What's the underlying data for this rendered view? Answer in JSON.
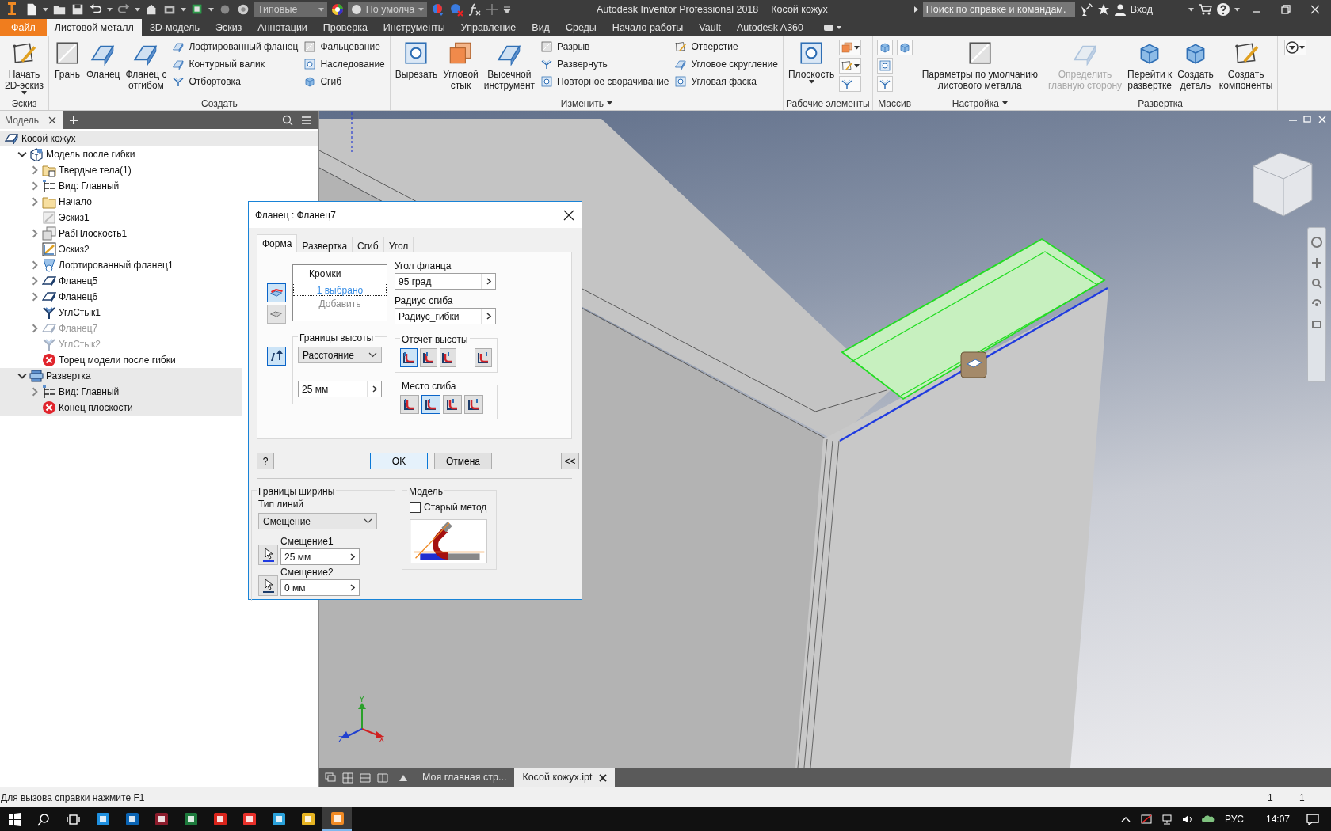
{
  "title_bar": {
    "style_dropdown": "Типовые",
    "appearance_dropdown": "По умолча",
    "title": "Autodesk Inventor Professional 2018",
    "document": "Косой кожух",
    "search": {
      "placeholder": "Поиск по справке и командам."
    },
    "sign_in": "Вход"
  },
  "ribbon_tabs": [
    {
      "label": "Файл",
      "kind": "file",
      "selected": false
    },
    {
      "label": "Листовой металл",
      "kind": "tab",
      "selected": true
    },
    {
      "label": "3D-модель",
      "kind": "tab",
      "selected": false
    },
    {
      "label": "Эскиз",
      "kind": "tab",
      "selected": false
    },
    {
      "label": "Аннотации",
      "kind": "tab",
      "selected": false
    },
    {
      "label": "Проверка",
      "kind": "tab",
      "selected": false
    },
    {
      "label": "Инструменты",
      "kind": "tab",
      "selected": false
    },
    {
      "label": "Управление",
      "kind": "tab",
      "selected": false
    },
    {
      "label": "Вид",
      "kind": "tab",
      "selected": false
    },
    {
      "label": "Среды",
      "kind": "tab",
      "selected": false
    },
    {
      "label": "Начало работы",
      "kind": "tab",
      "selected": false
    },
    {
      "label": "Vault",
      "kind": "tab",
      "selected": false
    },
    {
      "label": "Autodesk A360",
      "kind": "tab",
      "selected": false
    }
  ],
  "ribbon_panels": [
    {
      "label": "Эскиз",
      "menu": false,
      "groups": [
        {
          "kind": "large",
          "items": [
            {
              "label": "Начать\n2D-эскиз",
              "dropdown": true,
              "disabled": false
            }
          ]
        }
      ]
    },
    {
      "label": "Создать",
      "menu": false,
      "groups": [
        {
          "kind": "large",
          "items": [
            {
              "label": "Грань",
              "dropdown": false,
              "disabled": false
            },
            {
              "label": "Фланец",
              "dropdown": false,
              "disabled": false
            },
            {
              "label": "Фланец с\nотгибом",
              "dropdown": false,
              "disabled": false
            }
          ]
        },
        {
          "kind": "small",
          "items": [
            {
              "label": "Лофтированный фланец",
              "dropdown": false,
              "disabled": false
            },
            {
              "label": "Контурный валик",
              "dropdown": false,
              "disabled": false
            },
            {
              "label": "Отбортовка",
              "dropdown": false,
              "disabled": false
            }
          ]
        },
        {
          "kind": "small",
          "items": [
            {
              "label": "Фальцевание",
              "dropdown": false,
              "disabled": false
            },
            {
              "label": "Наследование",
              "dropdown": false,
              "disabled": false
            },
            {
              "label": "Сгиб",
              "dropdown": false,
              "disabled": false
            }
          ]
        }
      ]
    },
    {
      "label": "Изменить",
      "menu": true,
      "groups": [
        {
          "kind": "large",
          "items": [
            {
              "label": "Вырезать",
              "dropdown": false,
              "disabled": false
            },
            {
              "label": "Угловой\nстык",
              "dropdown": false,
              "disabled": false
            },
            {
              "label": "Высечной\nинструмент",
              "dropdown": false,
              "disabled": false
            }
          ]
        },
        {
          "kind": "small",
          "items": [
            {
              "label": "Разрыв",
              "dropdown": false,
              "disabled": false
            },
            {
              "label": "Развернуть",
              "dropdown": false,
              "disabled": false
            },
            {
              "label": "Повторное сворачивание",
              "dropdown": false,
              "disabled": false
            }
          ]
        },
        {
          "kind": "small",
          "items": [
            {
              "label": "Отверстие",
              "dropdown": false,
              "disabled": false
            },
            {
              "label": "Угловое скругление",
              "dropdown": false,
              "disabled": false
            },
            {
              "label": "Угловая фаска",
              "dropdown": false,
              "disabled": false
            }
          ]
        }
      ]
    },
    {
      "label": "Рабочие элементы",
      "menu": false,
      "groups": [
        {
          "kind": "large",
          "items": [
            {
              "label": "Плоскость",
              "dropdown": true,
              "disabled": false
            }
          ]
        },
        {
          "kind": "icons",
          "items": [
            {
              "dropdown": true,
              "disabled": false
            },
            {
              "dropdown": true,
              "disabled": false
            },
            {
              "dropdown": false,
              "disabled": false
            }
          ]
        }
      ]
    },
    {
      "label": "Массив",
      "menu": false,
      "groups": [
        {
          "kind": "icons",
          "items": [
            {
              "dropdown": false,
              "disabled": false
            },
            {
              "dropdown": false,
              "disabled": false
            },
            {
              "dropdown": false,
              "disabled": false
            }
          ]
        },
        {
          "kind": "icons",
          "items": [
            {
              "dropdown": false,
              "disabled": false
            }
          ]
        }
      ]
    },
    {
      "label": "Настройка",
      "menu": true,
      "groups": [
        {
          "kind": "large",
          "items": [
            {
              "label": "Параметры по умолчанию\nлистового металла",
              "dropdown": false,
              "disabled": false
            }
          ]
        }
      ]
    },
    {
      "label": "Развертка",
      "menu": false,
      "groups": [
        {
          "kind": "large",
          "items": [
            {
              "label": "Определить\nглавную сторону",
              "dropdown": false,
              "disabled": true
            },
            {
              "label": "Перейти к\nразвертке",
              "dropdown": false,
              "disabled": false
            },
            {
              "label": "Создать\nдеталь",
              "dropdown": false,
              "disabled": false
            },
            {
              "label": "Создать\nкомпоненты",
              "dropdown": false,
              "disabled": false
            }
          ]
        }
      ]
    }
  ],
  "browser": {
    "tabs": [
      {
        "label": "Модель",
        "selected": true
      }
    ],
    "tree": [
      {
        "label": "Косой кожух",
        "kind": "part",
        "expandable": false,
        "highlighted": true,
        "dimmed": false,
        "children": [
          {
            "label": "Модель после гибки",
            "kind": "model",
            "expandable": true,
            "expanded": true,
            "highlighted": false,
            "dimmed": false,
            "children": [
              {
                "label": "Твердые тела(1)",
                "kind": "bodies",
                "expandable": true,
                "expanded": false,
                "highlighted": false,
                "dimmed": false
              },
              {
                "label": "Вид: Главный",
                "kind": "view",
                "expandable": true,
                "expanded": false,
                "highlighted": false,
                "dimmed": false
              },
              {
                "label": "Начало",
                "kind": "folder",
                "expandable": true,
                "expanded": false,
                "highlighted": false,
                "dimmed": false
              },
              {
                "label": "Эскиз1",
                "kind": "sketch_off",
                "expandable": false,
                "highlighted": false,
                "dimmed": false
              },
              {
                "label": "РабПлоскость1",
                "kind": "plane",
                "expandable": true,
                "expanded": false,
                "highlighted": false,
                "dimmed": false
              },
              {
                "label": "Эскиз2",
                "kind": "sketch",
                "expandable": false,
                "highlighted": false,
                "dimmed": false
              },
              {
                "label": "Лофтированный фланец1",
                "kind": "loft",
                "expandable": true,
                "expanded": false,
                "highlighted": false,
                "dimmed": false
              },
              {
                "label": "Фланец5",
                "kind": "flange",
                "expandable": true,
                "expanded": false,
                "highlighted": false,
                "dimmed": false
              },
              {
                "label": "Фланец6",
                "kind": "flange",
                "expandable": true,
                "expanded": false,
                "highlighted": false,
                "dimmed": false
              },
              {
                "label": "УглСтык1",
                "kind": "corner",
                "expandable": false,
                "highlighted": false,
                "dimmed": false
              },
              {
                "label": "Фланец7",
                "kind": "flange",
                "expandable": true,
                "expanded": false,
                "highlighted": false,
                "dimmed": true
              },
              {
                "label": "УглСтык2",
                "kind": "corner",
                "expandable": false,
                "highlighted": false,
                "dimmed": true
              },
              {
                "label": "Торец модели после гибки",
                "kind": "error",
                "expandable": false,
                "highlighted": false,
                "dimmed": false
              }
            ]
          },
          {
            "label": "Развертка",
            "kind": "flat",
            "expandable": true,
            "expanded": true,
            "highlighted": true,
            "dimmed": false,
            "children": [
              {
                "label": "Вид: Главный",
                "kind": "view",
                "expandable": true,
                "expanded": false,
                "highlighted": true,
                "dimmed": false
              },
              {
                "label": "Конец плоскости",
                "kind": "error",
                "expandable": false,
                "highlighted": true,
                "dimmed": false
              }
            ]
          }
        ]
      }
    ]
  },
  "axes": [
    "X",
    "Y",
    "Z"
  ],
  "document_tabs": [
    {
      "label": "Моя главная стр...",
      "selected": false
    },
    {
      "label": "Косой кожух.ipt",
      "selected": true
    }
  ],
  "dialog": {
    "title": "Фланец : Фланец7",
    "tabs": [
      {
        "label": "Форма",
        "selected": true
      },
      {
        "label": "Развертка",
        "selected": false
      },
      {
        "label": "Сгиб",
        "selected": false
      },
      {
        "label": "Угол",
        "selected": false
      }
    ],
    "edge_modes": [
      {
        "selected": true
      },
      {
        "selected": false
      }
    ],
    "flip_direction": {
      "on": true
    },
    "edges": {
      "header": "Кромки",
      "items": [
        {
          "label": "1 выбрано",
          "selected": true
        },
        {
          "label": "Добавить",
          "selected": false
        }
      ]
    },
    "flange_angle": {
      "label": "Угол фланца",
      "value": "95 град"
    },
    "bend_radius": {
      "label": "Радиус сгиба",
      "value": "Радиус_гибки"
    },
    "height_extents": {
      "title": "Границы высоты",
      "type": "Расстояние",
      "value": "25 мм"
    },
    "height_datum": {
      "title": "Отсчет высоты",
      "options": [
        {
          "selected": true
        },
        {
          "selected": false
        },
        {
          "selected": false
        },
        {
          "selected": false
        }
      ]
    },
    "bend_position": {
      "title": "Место сгиба",
      "options": [
        {
          "selected": false
        },
        {
          "selected": true
        },
        {
          "selected": false
        },
        {
          "selected": false
        }
      ]
    },
    "help_label": "?",
    "buttons": [
      {
        "label": "OK",
        "kind": "default"
      },
      {
        "label": "Отмена",
        "kind": "normal"
      }
    ],
    "more_button": "<<",
    "width_extents": {
      "title": "Границы ширины",
      "line_type_label": "Тип линий",
      "line_type": "Смещение",
      "offsets": [
        {
          "label": "Смещение1",
          "value": "25 мм"
        },
        {
          "label": "Смещение2",
          "value": "0 мм"
        }
      ]
    },
    "model": {
      "title": "Модель",
      "old_method": {
        "label": "Старый метод",
        "checked": false
      }
    }
  },
  "status_bar": {
    "message": "Для вызова справки нажмите F1",
    "fields": [
      "1",
      "1"
    ]
  },
  "taskbar": {
    "apps": [
      {
        "color": "#1e90e0",
        "active": false
      },
      {
        "color": "#0a64b4",
        "active": false
      },
      {
        "color": "#8c1c2c",
        "active": false
      },
      {
        "color": "#1d7a3c",
        "active": false
      },
      {
        "color": "#d9241b",
        "active": false
      },
      {
        "color": "#e8302a",
        "active": false
      },
      {
        "color": "#2aa1da",
        "active": false
      },
      {
        "color": "#e6b422",
        "active": false
      },
      {
        "color": "#f08a24",
        "active": true
      }
    ],
    "language": "РУС",
    "time": "14:07"
  }
}
